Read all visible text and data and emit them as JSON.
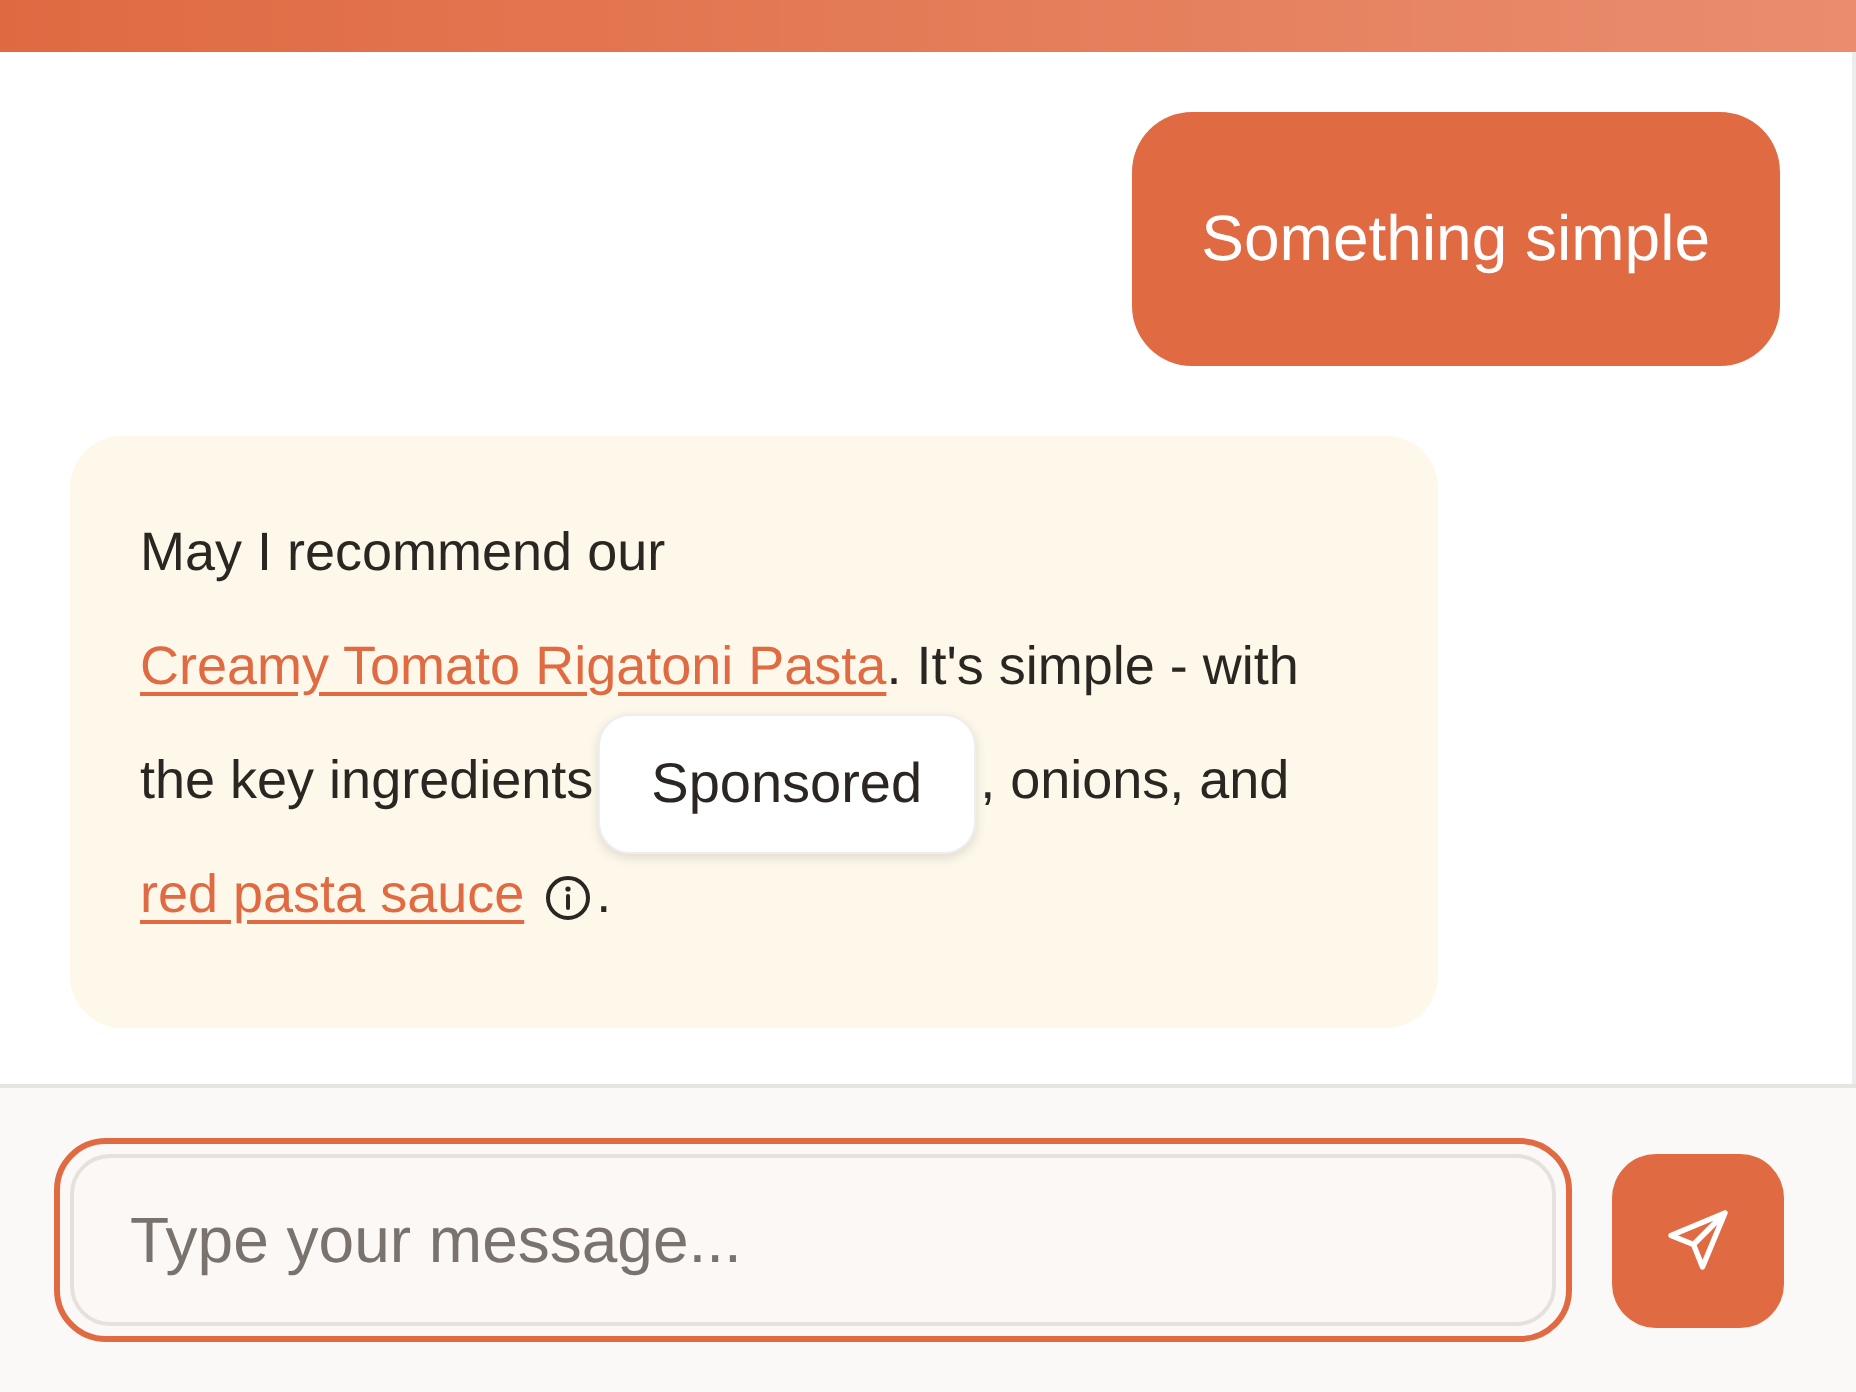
{
  "messages": [
    {
      "kind": "user",
      "text": "Something simple"
    },
    {
      "kind": "assistant",
      "parts": [
        {
          "kind": "text",
          "text": "May I recommend our "
        },
        {
          "kind": "link",
          "text": "Creamy Tomato Rigatoni Pasta"
        },
        {
          "kind": "text",
          "text": ". It's simple - with the key ingredients"
        },
        {
          "kind": "tooltip",
          "text": "Sponsored"
        },
        {
          "kind": "text",
          "text": ", onions, and "
        },
        {
          "kind": "link",
          "text": "red pasta sauce"
        },
        {
          "kind": "info"
        },
        {
          "kind": "text",
          "text": "."
        }
      ]
    }
  ],
  "composer": {
    "placeholder": "Type your message...",
    "focused": true
  }
}
